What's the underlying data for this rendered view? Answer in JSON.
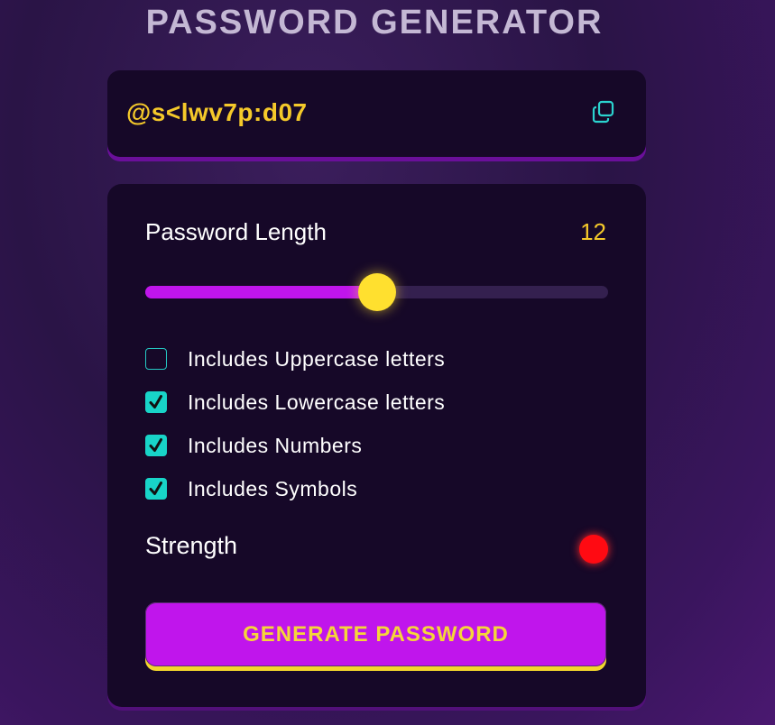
{
  "app": {
    "title": "PASSWORD GENERATOR"
  },
  "display": {
    "password": "@s<lwv7p:d07",
    "copy_icon": "copy-icon"
  },
  "length": {
    "label": "Password Length",
    "value": "12",
    "min": 4,
    "max": 20,
    "current": 12
  },
  "options": [
    {
      "label": "Includes Uppercase letters",
      "checked": false
    },
    {
      "label": "Includes Lowercase letters",
      "checked": true
    },
    {
      "label": "Includes Numbers",
      "checked": true
    },
    {
      "label": "Includes Symbols",
      "checked": true
    }
  ],
  "strength": {
    "label": "Strength",
    "indicator_color": "#ff0a12"
  },
  "generate": {
    "label": "GENERATE PASSWORD"
  },
  "colors": {
    "accent": "#c015ec",
    "highlight": "#f5c92a",
    "check": "#18d4c8"
  }
}
